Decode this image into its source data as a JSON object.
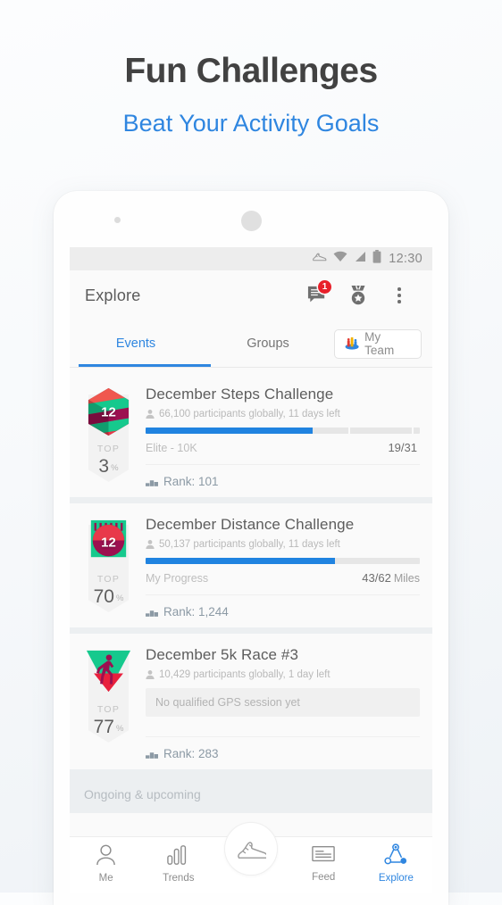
{
  "hero": {
    "title": "Fun Challenges",
    "subtitle": "Beat Your Activity Goals",
    "subtitle_color": "#2f86e0"
  },
  "statusbar": {
    "icons": [
      "shoe-icon",
      "wifi-icon",
      "signal-icon",
      "battery-icon"
    ],
    "time": "12:30"
  },
  "appbar": {
    "title": "Explore",
    "messages_badge": "1",
    "actions": [
      "messages-icon",
      "medal-icon",
      "overflow-menu-icon"
    ]
  },
  "tabs": {
    "items": [
      {
        "label": "Events",
        "active": true
      },
      {
        "label": "Groups",
        "active": false
      }
    ],
    "my_team_label": "My Team",
    "active_color": "#2f86e0"
  },
  "cards": [
    {
      "title": "December Steps Challenge",
      "meta": "66,100 participants globally, 11 days left",
      "badge_number": "12",
      "top_label": "TOP",
      "top_value": "3",
      "top_unit": "%",
      "progress_percent": 61,
      "progress_label": "Elite - 10K",
      "progress_value": "19/31",
      "progress_unit": "",
      "rank": "Rank: 101",
      "no_session_note": ""
    },
    {
      "title": "December Distance Challenge",
      "meta": "50,137 participants globally, 11 days left",
      "badge_number": "12",
      "top_label": "TOP",
      "top_value": "70",
      "top_unit": "%",
      "progress_percent": 69,
      "progress_label": "My Progress",
      "progress_value": "43/62",
      "progress_unit": "Miles",
      "rank": "Rank: 1,244",
      "no_session_note": ""
    },
    {
      "title": "December 5k Race #3",
      "meta": "10,429 participants globally, 1 day left",
      "badge_number": "",
      "top_label": "TOP",
      "top_value": "77",
      "top_unit": "%",
      "progress_percent": 0,
      "progress_label": "",
      "progress_value": "",
      "progress_unit": "",
      "rank": "Rank: 283",
      "no_session_note": "No qualified GPS session yet"
    }
  ],
  "section_header": "Ongoing & upcoming",
  "bottomnav": {
    "items": [
      {
        "label": "Me",
        "icon": "person-icon",
        "active": false
      },
      {
        "label": "Trends",
        "icon": "bar-chart-icon",
        "active": false
      },
      {
        "label": "Feed",
        "icon": "feed-icon",
        "active": false
      },
      {
        "label": "Explore",
        "icon": "share-network-icon",
        "active": true
      }
    ],
    "fab_icon": "running-shoe-icon",
    "active_color": "#2f86e0"
  },
  "colors": {
    "accent_blue": "#2083e0",
    "badge_red": "#e8202a",
    "medal_green": "#16c98d",
    "medal_crimson": "#e8394a",
    "medal_magenta": "#9c1050"
  }
}
